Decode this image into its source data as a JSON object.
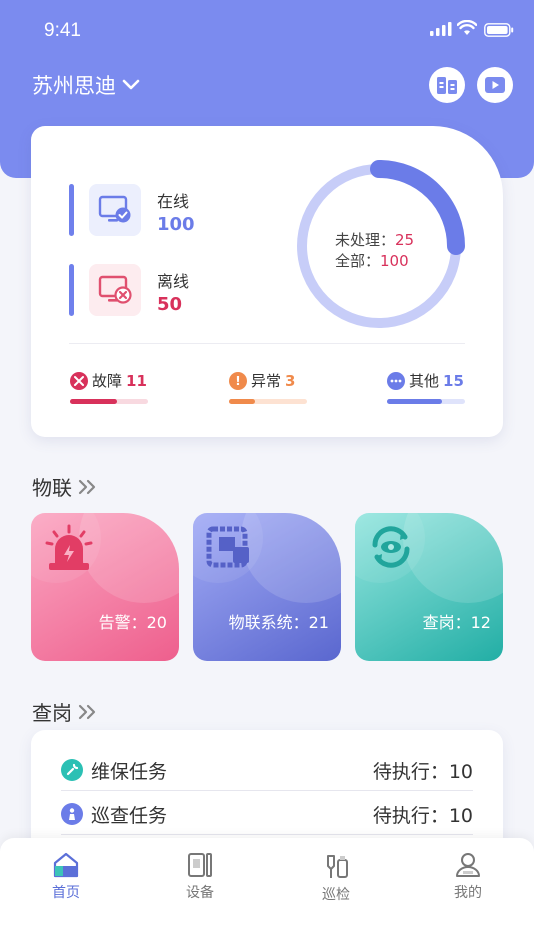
{
  "status_bar": {
    "time": "9:41"
  },
  "header": {
    "company": "苏州思迪"
  },
  "summary": {
    "online_label": "在线",
    "online_value": "100",
    "offline_label": "离线",
    "offline_value": "50",
    "pending_label": "未处理：",
    "pending_value": "25",
    "total_label": "全部：",
    "total_value": "100",
    "pending_fraction": 0.25,
    "fault_label": "故障",
    "fault_value": "11",
    "fault_fraction": 0.6,
    "abnormal_label": "异常",
    "abnormal_value": "3",
    "abnormal_fraction": 0.33,
    "other_label": "其他",
    "other_value": "15",
    "other_fraction": 0.7
  },
  "iot": {
    "title": "物联",
    "tiles": [
      {
        "label": "告警：20",
        "icon": "alarm-bell-icon"
      },
      {
        "label": "物联系统：21",
        "icon": "iot-system-icon"
      },
      {
        "label": "查岗：12",
        "icon": "patrol-eye-icon"
      }
    ]
  },
  "check": {
    "title": "查岗",
    "tasks": [
      {
        "name": "维保任务",
        "status": "待执行：10",
        "icon": "wrench-icon"
      },
      {
        "name": "巡查任务",
        "status": "待执行：10",
        "icon": "inspector-icon"
      }
    ]
  },
  "tabbar": {
    "items": [
      {
        "label": "首页",
        "icon": "home-icon"
      },
      {
        "label": "设备",
        "icon": "device-icon"
      },
      {
        "label": "巡检",
        "icon": "inspect-icon"
      },
      {
        "label": "我的",
        "icon": "profile-icon"
      }
    ]
  },
  "colors": {
    "primary": "#7b8bef",
    "accent_red": "#d8315b",
    "accent_orange": "#f08a4b",
    "accent_blue": "#6b7ce8",
    "teal": "#2bc0b4"
  }
}
